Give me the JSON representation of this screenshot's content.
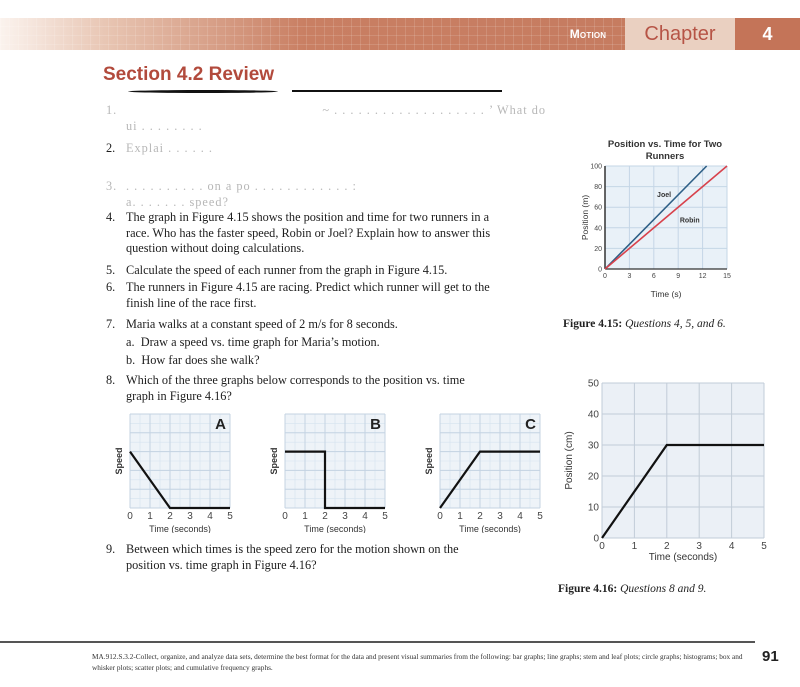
{
  "header": {
    "unit_label": "Motion",
    "chapter_label": "Chapter",
    "chapter_number": "4",
    "colors": {
      "banner": "#c47a5f",
      "title": "#b24a3c",
      "chapter_box": "#ead0c1"
    }
  },
  "section_title": "Section 4.2 Review",
  "questions": [
    {
      "num": "1.",
      "lines": [
        "~ . . . . . . . . . . . . . . . . . . . ’ What do",
        "ui . . . . . . . ."
      ]
    },
    {
      "num": "2.",
      "lines": [
        "Explai . . . . . ."
      ]
    },
    {
      "num": "3.",
      "lines": [
        ". . . . . . . . . . on a po . . . . . . . . . . . . :",
        "a. . . . . . . speed?"
      ]
    },
    {
      "num": "4.",
      "lines": [
        "The graph in Figure 4.15 shows the position and time for two runners in a",
        "race. Who has the faster speed, Robin or Joel? Explain how to answer this",
        "question without doing calculations."
      ]
    },
    {
      "num": "5.",
      "lines": [
        "Calculate the speed of each runner from the graph in Figure 4.15."
      ]
    },
    {
      "num": "6.",
      "lines": [
        "The runners in Figure 4.15 are racing. Predict which runner will get to the",
        "finish line of the race first."
      ]
    },
    {
      "num": "7.",
      "lines": [
        "Maria walks at a constant speed of 2 m/s for 8 seconds."
      ],
      "sub": [
        {
          "label": "a.",
          "text": "Draw a speed vs. time graph for Maria’s motion."
        },
        {
          "label": "b.",
          "text": "How far does she walk?"
        }
      ]
    },
    {
      "num": "8.",
      "lines": [
        "Which of the three graphs below corresponds to the position vs. time",
        "graph in Figure 4.16?"
      ]
    },
    {
      "num": "9.",
      "lines": [
        "Between which times is the speed zero for the motion shown on the",
        "position vs. time graph in Figure 4.16?"
      ]
    }
  ],
  "figures": {
    "fig415": {
      "caption_label": "Figure 4.15:",
      "caption_text": "Questions 4, 5, and 6."
    },
    "fig416": {
      "caption_label": "Figure 4.16:",
      "caption_text": "Questions 8 and 9."
    }
  },
  "chart_data": [
    {
      "id": "fig415",
      "type": "line",
      "title": "Position vs. Time for Two Runners",
      "xlabel": "Time (s)",
      "ylabel": "Position (m)",
      "xlim": [
        0,
        15
      ],
      "ylim": [
        0,
        100
      ],
      "xticks": [
        0,
        3,
        6,
        9,
        12,
        15
      ],
      "yticks": [
        0,
        20,
        40,
        60,
        80,
        100
      ],
      "grid": true,
      "series": [
        {
          "name": "Joel",
          "color": "#2e5f86",
          "x": [
            0,
            12.5
          ],
          "y": [
            0,
            100
          ]
        },
        {
          "name": "Robin",
          "color": "#d8424c",
          "x": [
            0,
            15
          ],
          "y": [
            0,
            100
          ]
        }
      ]
    },
    {
      "id": "fig416",
      "type": "line",
      "title": "",
      "xlabel": "Time (seconds)",
      "ylabel": "Position (cm)",
      "xlim": [
        0,
        5
      ],
      "ylim": [
        0,
        50
      ],
      "xticks": [
        0,
        1,
        2,
        3,
        4,
        5
      ],
      "yticks": [
        0,
        10,
        20,
        30,
        40,
        50
      ],
      "grid": true,
      "series": [
        {
          "name": "position",
          "color": "#111111",
          "x": [
            0,
            2,
            5
          ],
          "y": [
            0,
            30,
            30
          ]
        }
      ]
    },
    {
      "id": "graphA",
      "type": "line",
      "title": "A",
      "xlabel": "Time (seconds)",
      "ylabel": "Speed",
      "xlim": [
        0,
        5
      ],
      "ylim": [
        0,
        5
      ],
      "xticks": [
        0,
        1,
        2,
        3,
        4,
        5
      ],
      "grid": true,
      "series": [
        {
          "name": "speed",
          "color": "#111111",
          "x": [
            0,
            2,
            5
          ],
          "y": [
            3,
            0,
            0
          ]
        }
      ]
    },
    {
      "id": "graphB",
      "type": "line",
      "title": "B",
      "xlabel": "Time (seconds)",
      "ylabel": "Speed",
      "xlim": [
        0,
        5
      ],
      "ylim": [
        0,
        5
      ],
      "xticks": [
        0,
        1,
        2,
        3,
        4,
        5
      ],
      "grid": true,
      "series": [
        {
          "name": "speed",
          "color": "#111111",
          "x": [
            0,
            2,
            2,
            5
          ],
          "y": [
            3,
            3,
            0,
            0
          ]
        }
      ]
    },
    {
      "id": "graphC",
      "type": "line",
      "title": "C",
      "xlabel": "Time (seconds)",
      "ylabel": "Speed",
      "xlim": [
        0,
        5
      ],
      "ylim": [
        0,
        5
      ],
      "xticks": [
        0,
        1,
        2,
        3,
        4,
        5
      ],
      "grid": true,
      "series": [
        {
          "name": "speed",
          "color": "#111111",
          "x": [
            0,
            2,
            5
          ],
          "y": [
            0,
            3,
            3
          ]
        }
      ]
    }
  ],
  "footer": {
    "standard_text": "MA.912.S.3.2-Collect, organize, and analyze data sets, determine the best format for the data and present visual summaries from the following: bar graphs; line graphs; stem and leaf plots; circle graphs; histograms; box and whisker plots; scatter plots; and cumulative frequency graphs.",
    "page_number": "91"
  }
}
